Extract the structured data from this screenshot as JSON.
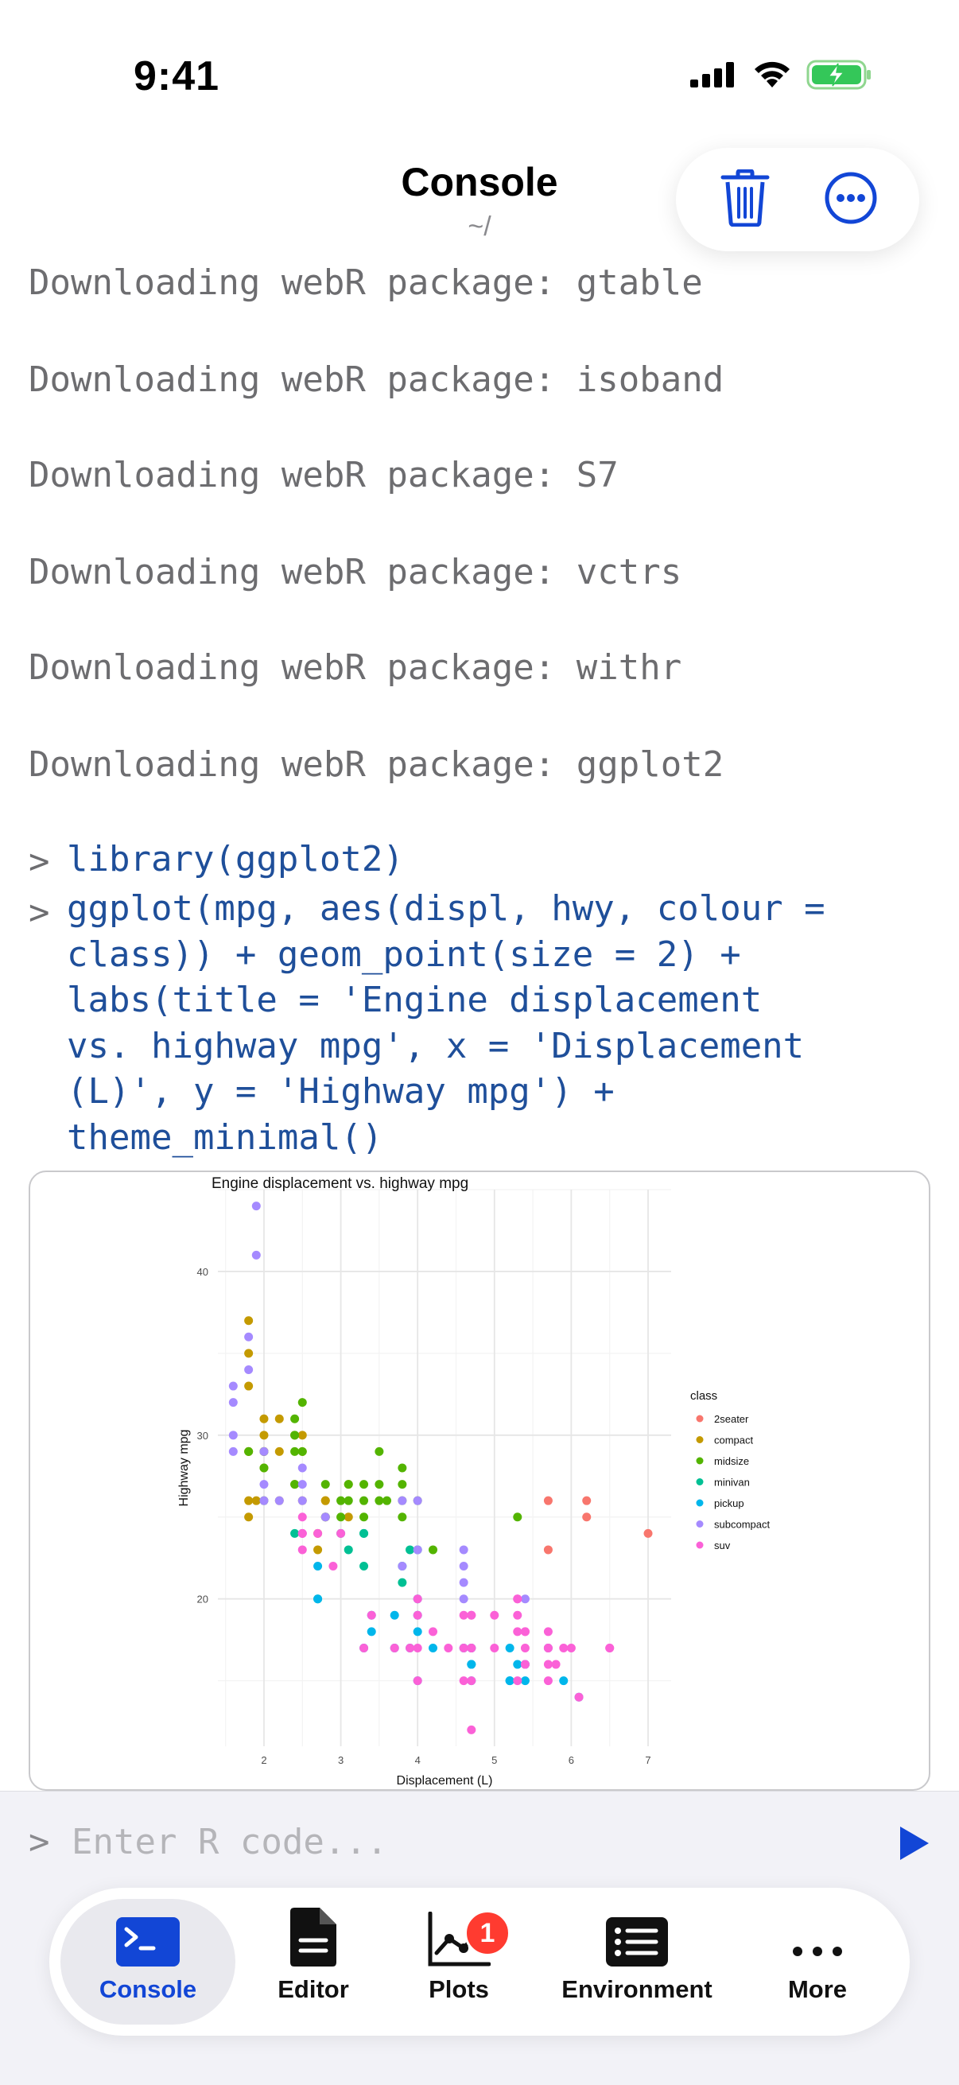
{
  "status_bar": {
    "time": "9:41"
  },
  "header": {
    "title": "Console",
    "subtitle": "~/",
    "icons": [
      "trash-icon",
      "more-options-icon"
    ]
  },
  "console": {
    "log_lines": [
      "Downloading webR package: gtable",
      "Downloading webR package: isoband",
      "Downloading webR package: S7",
      "Downloading webR package: vctrs",
      "Downloading webR package: withr",
      "Downloading webR package: ggplot2"
    ],
    "prompt_symbol": ">",
    "commands": [
      "library(ggplot2)",
      "ggplot(mpg, aes(displ, hwy, colour =\nclass)) + geom_point(size = 2) +\nlabs(title = 'Engine displacement\nvs. highway mpg', x = 'Displacement\n(L)', y = 'Highway mpg') +\ntheme_minimal()"
    ]
  },
  "plot": {
    "chart_data": {
      "type": "scatter",
      "title": "Engine displacement vs. highway mpg",
      "xlabel": "Displacement (L)",
      "ylabel": "Highway mpg",
      "xlim": [
        1.4,
        7.3
      ],
      "ylim": [
        11,
        45
      ],
      "x_ticks": [
        "2",
        "3",
        "4",
        "5",
        "6",
        "7"
      ],
      "y_ticks": [
        "20",
        "30",
        "40"
      ],
      "grid": true,
      "legend": {
        "title": "class",
        "placement": "right"
      },
      "series": [
        {
          "name": "2seater",
          "color": "#F8766D",
          "points": [
            [
              5.7,
              26
            ],
            [
              5.7,
              23
            ],
            [
              6.2,
              26
            ],
            [
              6.2,
              25
            ],
            [
              7.0,
              24
            ]
          ]
        },
        {
          "name": "compact",
          "color": "#C49A00",
          "points": [
            [
              1.8,
              29
            ],
            [
              1.8,
              29
            ],
            [
              2.0,
              31
            ],
            [
              2.0,
              30
            ],
            [
              2.8,
              26
            ],
            [
              2.8,
              26
            ],
            [
              3.1,
              27
            ],
            [
              1.8,
              26
            ],
            [
              1.8,
              25
            ],
            [
              2.0,
              28
            ],
            [
              2.0,
              29
            ],
            [
              2.8,
              25
            ],
            [
              3.1,
              25
            ],
            [
              2.2,
              26
            ],
            [
              2.4,
              27
            ],
            [
              2.5,
              30
            ],
            [
              2.2,
              29
            ],
            [
              2.7,
              23
            ],
            [
              2.5,
              26
            ],
            [
              1.8,
              33
            ],
            [
              1.8,
              35
            ],
            [
              1.8,
              37
            ],
            [
              2.0,
              29
            ],
            [
              2.5,
              29
            ],
            [
              2.7,
              24
            ],
            [
              2.4,
              30
            ],
            [
              2.2,
              31
            ],
            [
              1.9,
              26
            ]
          ]
        },
        {
          "name": "midsize",
          "color": "#53B400",
          "points": [
            [
              2.4,
              27
            ],
            [
              2.4,
              30
            ],
            [
              3.1,
              26
            ],
            [
              3.5,
              29
            ],
            [
              3.6,
              26
            ],
            [
              2.4,
              31
            ],
            [
              2.5,
              32
            ],
            [
              3.0,
              26
            ],
            [
              3.3,
              26
            ],
            [
              3.8,
              26
            ],
            [
              3.8,
              28
            ],
            [
              4.0,
              26
            ],
            [
              2.4,
              29
            ],
            [
              2.5,
              29
            ],
            [
              3.3,
              27
            ],
            [
              3.5,
              26
            ],
            [
              3.3,
              25
            ],
            [
              2.0,
              28
            ],
            [
              2.0,
              29
            ],
            [
              2.8,
              27
            ],
            [
              3.0,
              25
            ],
            [
              3.5,
              27
            ],
            [
              4.2,
              23
            ],
            [
              5.3,
              25
            ],
            [
              1.8,
              29
            ],
            [
              2.0,
              26
            ],
            [
              2.8,
              25
            ],
            [
              3.8,
              25
            ],
            [
              3.1,
              27
            ],
            [
              3.8,
              27
            ]
          ]
        },
        {
          "name": "minivan",
          "color": "#00C094",
          "points": [
            [
              2.4,
              24
            ],
            [
              3.0,
              24
            ],
            [
              3.3,
              22
            ],
            [
              3.3,
              24
            ],
            [
              3.8,
              22
            ],
            [
              3.8,
              21
            ],
            [
              4.0,
              23
            ],
            [
              2.7,
              20
            ],
            [
              3.1,
              23
            ],
            [
              3.3,
              24
            ],
            [
              3.9,
              23
            ]
          ]
        },
        {
          "name": "pickup",
          "color": "#00B6EB",
          "points": [
            [
              3.7,
              19
            ],
            [
              4.7,
              17
            ],
            [
              4.7,
              16
            ],
            [
              5.2,
              17
            ],
            [
              5.7,
              17
            ],
            [
              5.9,
              15
            ],
            [
              4.7,
              16
            ],
            [
              5.2,
              15
            ],
            [
              3.9,
              17
            ],
            [
              4.7,
              17
            ],
            [
              5.4,
              16
            ],
            [
              3.4,
              19
            ],
            [
              3.4,
              18
            ],
            [
              4.0,
              20
            ],
            [
              4.2,
              17
            ],
            [
              4.6,
              17
            ],
            [
              5.4,
              15
            ],
            [
              2.7,
              22
            ],
            [
              4.0,
              18
            ],
            [
              2.7,
              20
            ],
            [
              3.3,
              17
            ],
            [
              4.7,
              15
            ],
            [
              5.2,
              15
            ],
            [
              6.1,
              14
            ],
            [
              4.0,
              15
            ],
            [
              3.7,
              17
            ],
            [
              5.3,
              16
            ],
            [
              4.0,
              19
            ]
          ]
        },
        {
          "name": "subcompact",
          "color": "#A58AFF",
          "points": [
            [
              1.6,
              33
            ],
            [
              1.6,
              32
            ],
            [
              1.6,
              29
            ],
            [
              1.8,
              34
            ],
            [
              1.8,
              36
            ],
            [
              1.9,
              44
            ],
            [
              1.9,
              41
            ],
            [
              2.0,
              26
            ],
            [
              2.0,
              29
            ],
            [
              2.5,
              26
            ],
            [
              2.5,
              27
            ],
            [
              4.6,
              23
            ],
            [
              5.4,
              20
            ],
            [
              4.6,
              21
            ],
            [
              4.0,
              26
            ],
            [
              4.6,
              20
            ],
            [
              5.4,
              16
            ],
            [
              3.8,
              22
            ],
            [
              3.8,
              26
            ],
            [
              4.6,
              22
            ],
            [
              2.2,
              26
            ],
            [
              2.5,
              28
            ],
            [
              2.5,
              24
            ],
            [
              1.6,
              30
            ],
            [
              2.0,
              27
            ],
            [
              2.8,
              25
            ],
            [
              4.0,
              23
            ]
          ]
        },
        {
          "name": "suv",
          "color": "#FB61D7",
          "points": [
            [
              5.3,
              20
            ],
            [
              5.3,
              15
            ],
            [
              5.3,
              20
            ],
            [
              5.7,
              17
            ],
            [
              6.0,
              17
            ],
            [
              5.7,
              18
            ],
            [
              6.5,
              17
            ],
            [
              4.7,
              12
            ],
            [
              4.7,
              19
            ],
            [
              4.7,
              17
            ],
            [
              5.7,
              17
            ],
            [
              6.1,
              14
            ],
            [
              5.3,
              19
            ],
            [
              5.4,
              18
            ],
            [
              4.0,
              17
            ],
            [
              4.7,
              19
            ],
            [
              4.2,
              18
            ],
            [
              4.4,
              17
            ],
            [
              4.6,
              17
            ],
            [
              4.6,
              15
            ],
            [
              5.4,
              16
            ],
            [
              5.4,
              18
            ],
            [
              4.0,
              20
            ],
            [
              5.0,
              17
            ],
            [
              3.7,
              17
            ],
            [
              4.7,
              17
            ],
            [
              5.7,
              15
            ],
            [
              3.3,
              17
            ],
            [
              3.9,
              17
            ],
            [
              2.5,
              23
            ],
            [
              2.5,
              24
            ],
            [
              2.7,
              24
            ],
            [
              2.9,
              22
            ],
            [
              3.4,
              19
            ],
            [
              4.0,
              19
            ],
            [
              4.0,
              15
            ],
            [
              2.5,
              24
            ],
            [
              2.5,
              25
            ],
            [
              3.0,
              24
            ],
            [
              5.7,
              16
            ],
            [
              5.3,
              18
            ],
            [
              4.7,
              15
            ],
            [
              5.8,
              16
            ],
            [
              4.6,
              19
            ],
            [
              5.4,
              17
            ],
            [
              5.0,
              19
            ],
            [
              5.9,
              17
            ],
            [
              6.5,
              17
            ]
          ]
        }
      ]
    }
  },
  "input": {
    "prompt_symbol": ">",
    "placeholder": "Enter R code...",
    "value": ""
  },
  "tab_bar": {
    "tabs": [
      {
        "label": "Console",
        "icon": "terminal-icon",
        "active": true
      },
      {
        "label": "Editor",
        "icon": "document-icon",
        "active": false
      },
      {
        "label": "Plots",
        "icon": "chart-icon",
        "active": false,
        "badge": "1"
      },
      {
        "label": "Environment",
        "icon": "list-icon",
        "active": false
      },
      {
        "label": "More",
        "icon": "ellipsis-icon",
        "active": false
      }
    ]
  },
  "colors": {
    "accent": "#1246d6",
    "command_text": "#1f4f9a",
    "log_text": "#6d6d70",
    "badge": "#ff3b30"
  }
}
